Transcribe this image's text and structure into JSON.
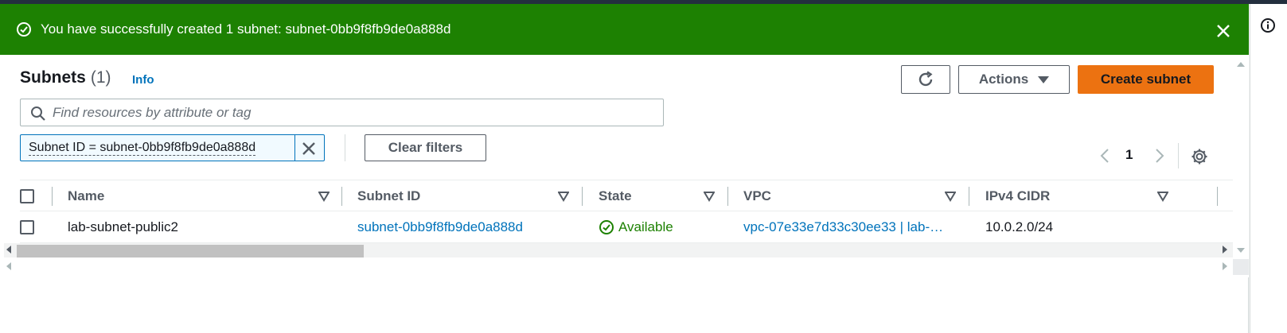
{
  "flash": {
    "message": "You have successfully created 1 subnet: subnet-0bb9f8fb9de0a888d",
    "type": "success",
    "color": "#1d8102"
  },
  "header": {
    "title": "Subnets",
    "count": "(1)",
    "info_label": "Info"
  },
  "toolbar": {
    "refresh_icon": "refresh-icon",
    "actions_label": "Actions",
    "create_label": "Create subnet",
    "create_color": "#ec7211"
  },
  "search": {
    "placeholder": "Find resources by attribute or tag",
    "value": ""
  },
  "filters": {
    "token_label": "Subnet ID = subnet-0bb9f8fb9de0a888d",
    "clear_label": "Clear filters"
  },
  "pagination": {
    "current_page": "1"
  },
  "table": {
    "columns": [
      "Name",
      "Subnet ID",
      "State",
      "VPC",
      "IPv4 CIDR"
    ],
    "rows": [
      {
        "name": "lab-subnet-public2",
        "subnet_id": "subnet-0bb9f8fb9de0a888d",
        "state": "Available",
        "vpc": "vpc-07e33e7d33c30ee33 | lab-…",
        "ipv4_cidr": "10.0.2.0/24"
      }
    ]
  }
}
